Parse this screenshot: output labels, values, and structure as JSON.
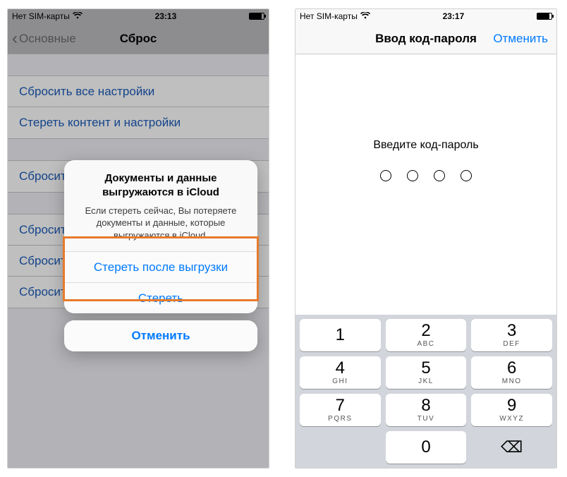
{
  "left": {
    "status": {
      "carrier": "Нет SIM-карты",
      "time": "23:13"
    },
    "nav": {
      "back": "Основные",
      "title": "Сброс"
    },
    "list1": [
      "Сбросить все настройки",
      "Стереть контент и настройки"
    ],
    "list2": [
      "Сбросить настройки сети"
    ],
    "list3": [
      "Сбросить словарь клавиатуры",
      "Сбросить настройки «Домой»",
      "Сбросить геонастройки"
    ],
    "alert": {
      "title_l1": "Документы и данные",
      "title_l2": "выгружаются в iCloud",
      "msg": "Если стереть сейчас, Вы потеряете документы и данные, которые выгружаются в iCloud.",
      "btn1": "Стереть после выгрузки",
      "btn2": "Стереть",
      "cancel": "Отменить"
    }
  },
  "right": {
    "status": {
      "carrier": "Нет SIM-карты",
      "time": "23:17"
    },
    "nav": {
      "title": "Ввод код-пароля",
      "cancel": "Отменить"
    },
    "prompt": "Введите код-пароль",
    "keys": [
      {
        "n": "1",
        "l": ""
      },
      {
        "n": "2",
        "l": "ABC"
      },
      {
        "n": "3",
        "l": "DEF"
      },
      {
        "n": "4",
        "l": "GHI"
      },
      {
        "n": "5",
        "l": "JKL"
      },
      {
        "n": "6",
        "l": "MNO"
      },
      {
        "n": "7",
        "l": "PQRS"
      },
      {
        "n": "8",
        "l": "TUV"
      },
      {
        "n": "9",
        "l": "WXYZ"
      },
      {
        "n": "0",
        "l": ""
      }
    ],
    "backspace": "⌫"
  }
}
